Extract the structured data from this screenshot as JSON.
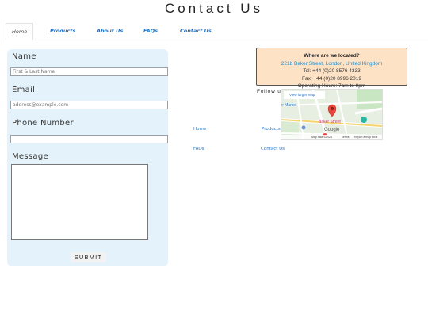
{
  "page_title": "Contact Us",
  "tabs": [
    {
      "label": "Home",
      "active": true
    },
    {
      "label": "Products",
      "active": false
    },
    {
      "label": "About Us",
      "active": false
    },
    {
      "label": "FAQs",
      "active": false
    },
    {
      "label": "Contact Us",
      "active": false
    }
  ],
  "form": {
    "name_label": "Name",
    "name_placeholder": "First & Last Name",
    "email_label": "Email",
    "email_placeholder": "address@example.com",
    "phone_label": "Phone Number",
    "phone_placeholder": "",
    "message_label": "Message",
    "submit_label": "SUBMIT"
  },
  "location": {
    "title": "Where are we located?",
    "address": "221b Baker Street, London, United Kingdom",
    "tel": "Tel: +44 (0)20 8576 4333",
    "fax": "Fax: +44 (0)20 8996 2019",
    "hours": "Operating Hours: 7am to 9pm"
  },
  "follow_text": "Follow us",
  "map": {
    "larger_map_link": "View larger map",
    "labels": [
      "e Market",
      "Baker Street",
      "Google",
      "Map data ©2023",
      "Terms",
      "Report a map error"
    ]
  },
  "footer_links": [
    "Home",
    "Products",
    "FAQs",
    "Contact Us"
  ],
  "colors": {
    "accent": "#1d72c5",
    "panel": "#e3f2fb",
    "info": "#fde2c6",
    "pin": "#e8443a"
  }
}
